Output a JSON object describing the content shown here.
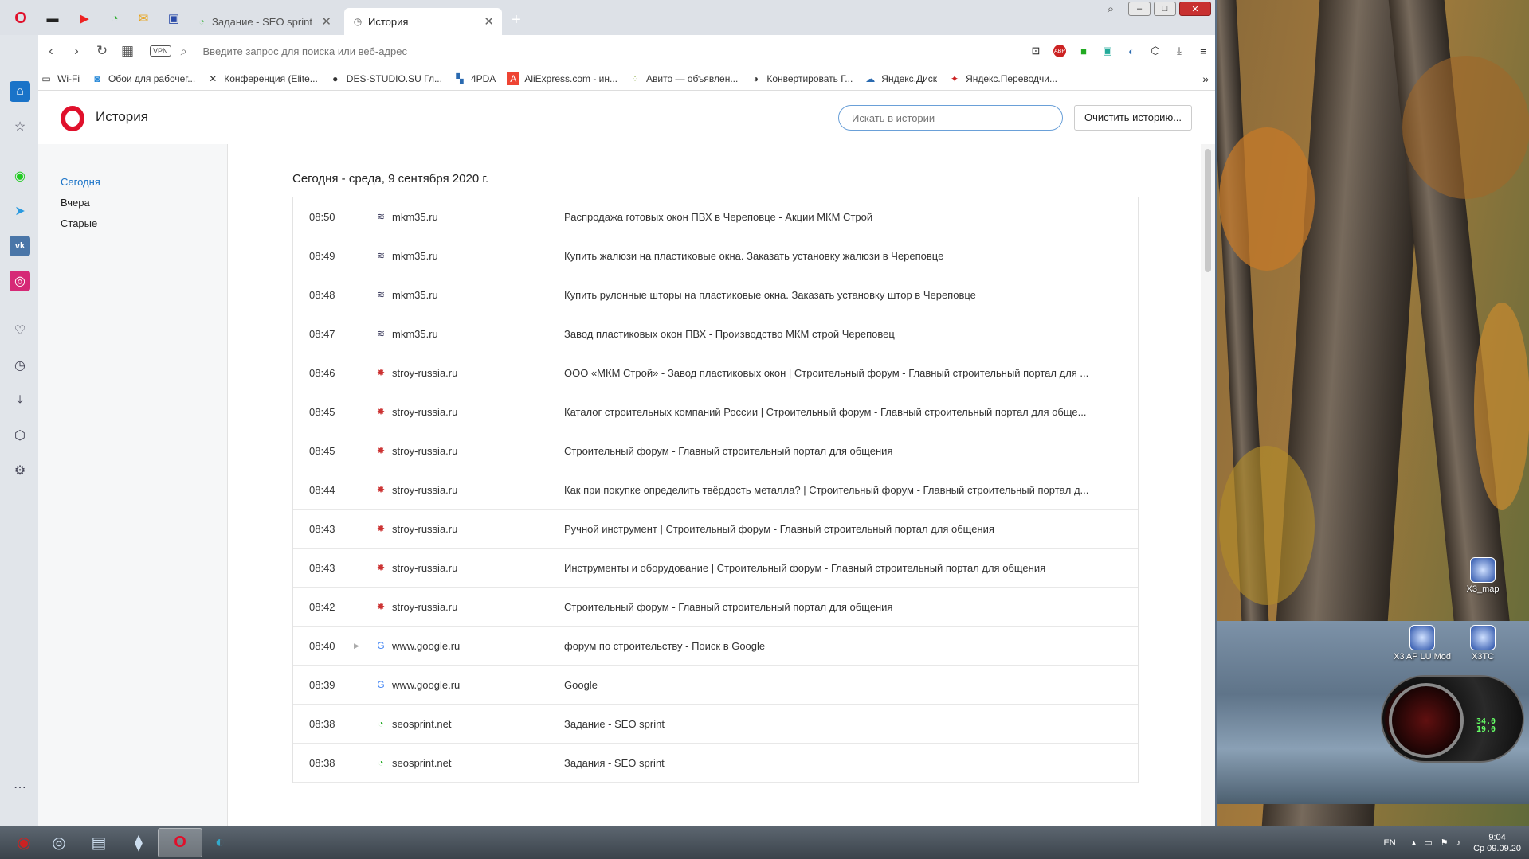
{
  "tabbar": {
    "speed_icons": [
      "opera-logo-icon",
      "speed-dial-icon",
      "youtube-icon",
      "seosprint-icon",
      "mail-icon",
      "messages-icon"
    ],
    "tabs": [
      {
        "title": "Задание - SEO sprint",
        "icon": "seosprint-icon",
        "active": false
      },
      {
        "title": "История",
        "icon": "history-clock-icon",
        "active": true
      }
    ],
    "new_tab": "+",
    "window_controls": [
      "search-tabs-icon",
      "minimize-icon",
      "maximize-icon",
      "close-icon"
    ]
  },
  "address_bar": {
    "vpn": "VPN",
    "placeholder": "Введите запрос для поиска или веб-адрес"
  },
  "bookmarks": [
    {
      "label": "Wi-Fi",
      "icon": "folder-icon"
    },
    {
      "label": "Обои для рабочег...",
      "icon": "wallpaper-icon"
    },
    {
      "label": "Конференция (Elite...",
      "icon": "elite-icon"
    },
    {
      "label": "DES-STUDIO.SU Гл...",
      "icon": "des-icon"
    },
    {
      "label": "4PDA",
      "icon": "4pda-icon"
    },
    {
      "label": "AliExpress.com - ин...",
      "icon": "aliexpress-icon"
    },
    {
      "label": "Авито — объявлен...",
      "icon": "avito-icon"
    },
    {
      "label": "Конвертировать Г...",
      "icon": "convert-icon"
    },
    {
      "label": "Яндекс.Диск",
      "icon": "yandex-disk-icon"
    },
    {
      "label": "Яндекс.Переводчи...",
      "icon": "yandex-translate-icon"
    }
  ],
  "page": {
    "title": "История",
    "search_placeholder": "Искать в истории",
    "clear_button": "Очистить историю...",
    "nav": [
      "Сегодня",
      "Вчера",
      "Старые"
    ],
    "date_heading": "Сегодня - среда, 9 сентября 2020 г."
  },
  "history": [
    {
      "time": "08:50",
      "domain": "mkm35.ru",
      "title": "Распродажа готовых окон ПВХ в Череповце - Акции МКМ Строй",
      "icon": "mkm-favicon"
    },
    {
      "time": "08:49",
      "domain": "mkm35.ru",
      "title": "Купить жалюзи на пластиковые окна. Заказать установку жалюзи в Череповце",
      "icon": "mkm-favicon"
    },
    {
      "time": "08:48",
      "domain": "mkm35.ru",
      "title": "Купить рулонные шторы на пластиковые окна. Заказать установку штор в Череповце",
      "icon": "mkm-favicon"
    },
    {
      "time": "08:47",
      "domain": "mkm35.ru",
      "title": "Завод пластиковых окон ПВХ - Производство МКМ строй Череповец",
      "icon": "mkm-favicon"
    },
    {
      "time": "08:46",
      "domain": "stroy-russia.ru",
      "title": "ООО «МКМ Строй» - Завод пластиковых окон | Строительный форум - Главный строительный портал для ...",
      "icon": "stroy-favicon"
    },
    {
      "time": "08:45",
      "domain": "stroy-russia.ru",
      "title": "Каталог строительных компаний России | Строительный форум - Главный строительный портал для обще...",
      "icon": "stroy-favicon"
    },
    {
      "time": "08:45",
      "domain": "stroy-russia.ru",
      "title": "Строительный форум - Главный строительный портал для общения",
      "icon": "stroy-favicon"
    },
    {
      "time": "08:44",
      "domain": "stroy-russia.ru",
      "title": "Как при покупке определить твёрдость металла? | Строительный форум - Главный строительный портал д...",
      "icon": "stroy-favicon"
    },
    {
      "time": "08:43",
      "domain": "stroy-russia.ru",
      "title": "Ручной инструмент | Строительный форум - Главный строительный портал для общения",
      "icon": "stroy-favicon"
    },
    {
      "time": "08:43",
      "domain": "stroy-russia.ru",
      "title": "Инструменты и оборудование | Строительный форум - Главный строительный портал для общения",
      "icon": "stroy-favicon"
    },
    {
      "time": "08:42",
      "domain": "stroy-russia.ru",
      "title": "Строительный форум - Главный строительный портал для общения",
      "icon": "stroy-favicon"
    },
    {
      "time": "08:40",
      "domain": "www.google.ru",
      "title": "форум по строительству - Поиск в Google",
      "icon": "google-favicon",
      "expandable": true
    },
    {
      "time": "08:39",
      "domain": "www.google.ru",
      "title": "Google",
      "icon": "google-favicon"
    },
    {
      "time": "08:38",
      "domain": "seosprint.net",
      "title": "Задание - SEO sprint",
      "icon": "seosprint-favicon"
    },
    {
      "time": "08:38",
      "domain": "seosprint.net",
      "title": "Задания - SEO sprint",
      "icon": "seosprint-favicon"
    }
  ],
  "sidebar_icons": [
    "home-icon",
    "bookmarks-star-icon",
    "whatsapp-icon",
    "telegram-icon",
    "vk-icon",
    "instagram-icon",
    "heart-icon",
    "history-icon",
    "downloads-icon",
    "extensions-cube-icon",
    "settings-gear-icon",
    "more-dots-icon"
  ],
  "desktop_icons": [
    {
      "label": "X3_map"
    },
    {
      "label": "X3 AP LU Mod"
    },
    {
      "label": "X3TC"
    }
  ],
  "gauge": {
    "line1": "34.0",
    "line2": "19.0"
  },
  "taskbar": {
    "items": [
      "start-icon",
      "taskbar-app-icon",
      "taskbar-explorer-icon",
      "taskbar-bottle-icon",
      "taskbar-opera-icon",
      "taskbar-edge-icon"
    ],
    "active": "taskbar-opera-icon"
  },
  "tray": {
    "lang": "EN",
    "time": "9:04",
    "date": "Ср 09.09.20"
  },
  "colors": {
    "opera_red": "#e0102b",
    "accent": "#1a73c8"
  }
}
